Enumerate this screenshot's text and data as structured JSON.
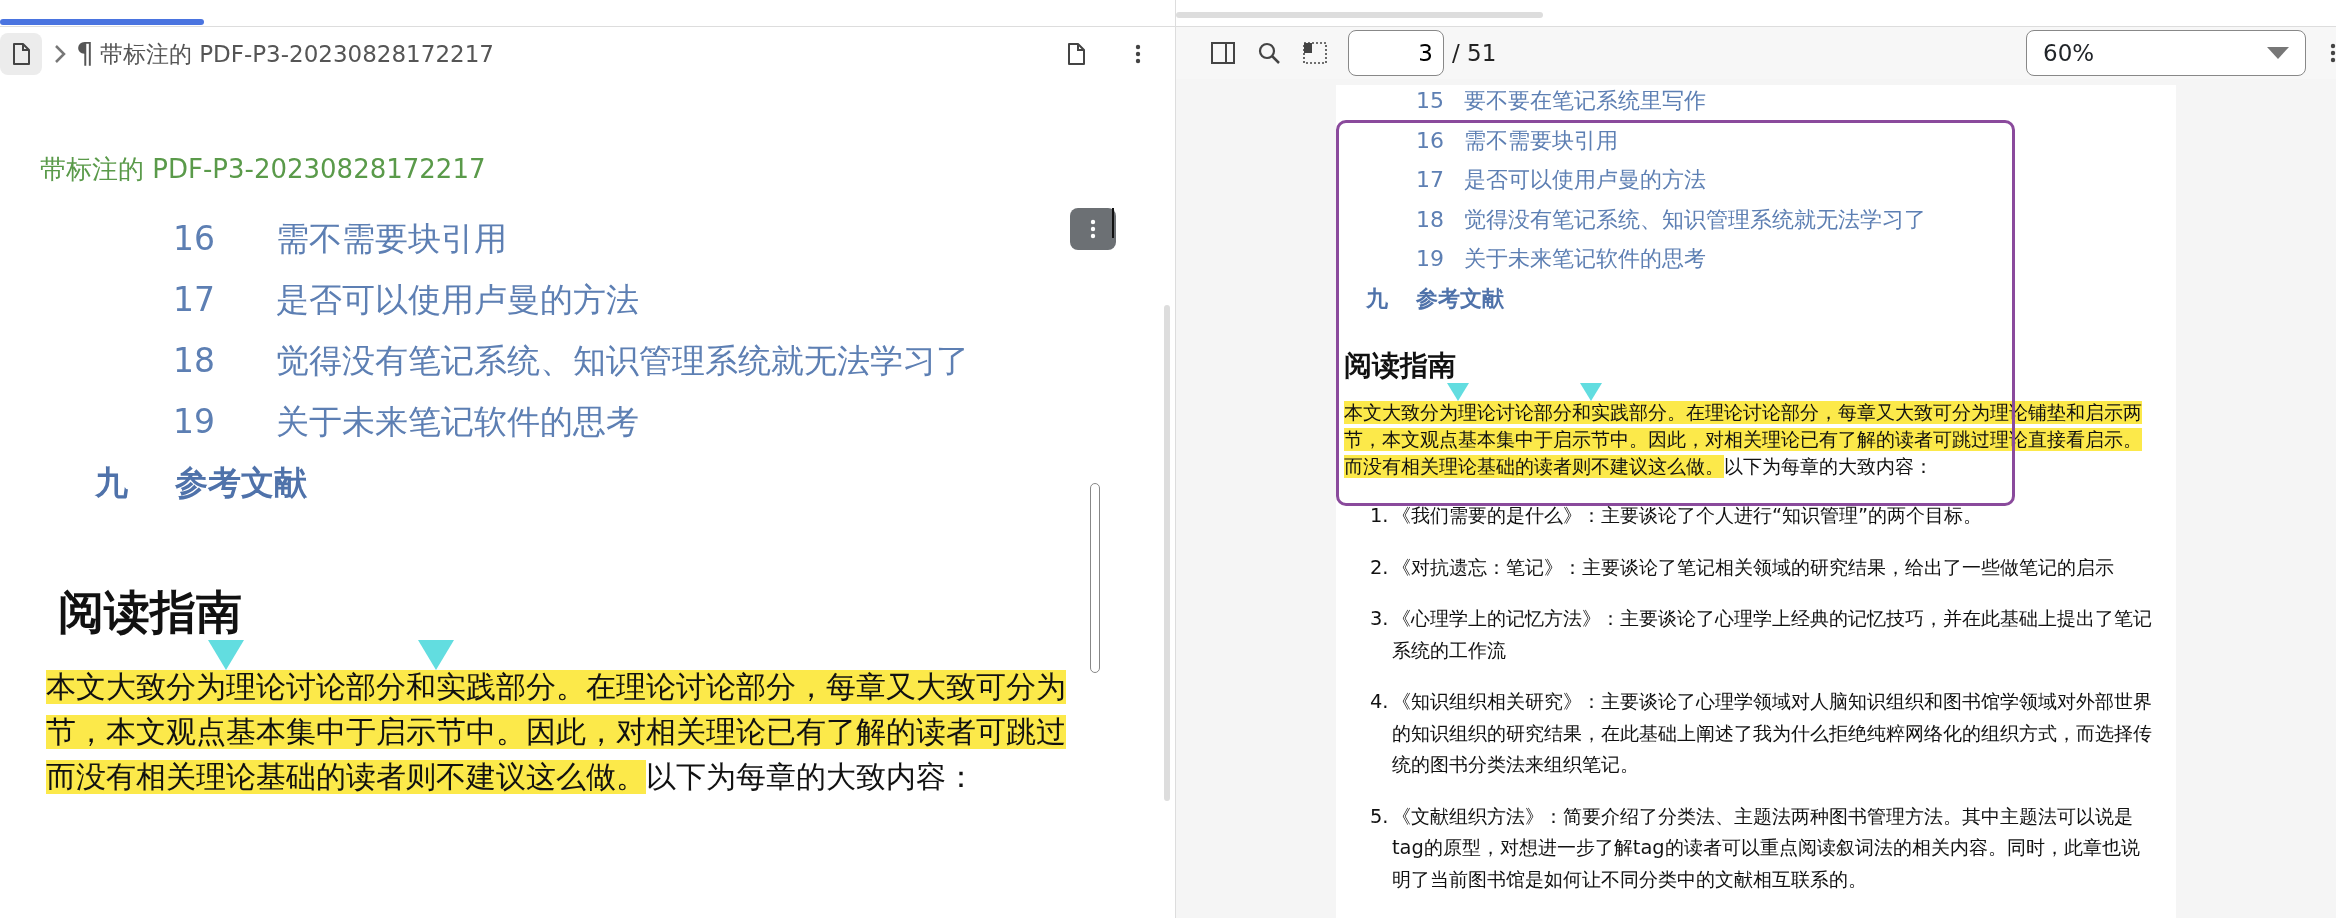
{
  "left_pane": {
    "header": {
      "pilcrow": "¶",
      "title": "带标注的 PDF-P3-20230828172217"
    },
    "note_title": "带标注的 PDF-P3-20230828172217",
    "image": {
      "toc": [
        {
          "number": "16",
          "text": "需不需要块引用"
        },
        {
          "number": "17",
          "text": "是否可以使用卢曼的方法"
        },
        {
          "number": "18",
          "text": "觉得没有笔记系统、知识管理系统就无法学习了"
        },
        {
          "number": "19",
          "text": "关于未来笔记软件的思考"
        }
      ],
      "chapter": {
        "number": "九",
        "text": "参考文献"
      },
      "heading": "阅读指南",
      "lines": [
        [
          {
            "kind": "text",
            "text": "本文大致分为",
            "highlighted": true
          },
          {
            "kind": "marker"
          },
          {
            "kind": "text",
            "text": "理论讨论部分和",
            "highlighted": true
          },
          {
            "kind": "marker"
          },
          {
            "kind": "text",
            "text": "实践部分。在理论讨论部分，每章又大致可分为",
            "highlighted": true
          }
        ],
        [
          {
            "kind": "text",
            "text": "节，本文观点基本集中于启示节中。因此，对相关理论已有了解的读者可跳过",
            "highlighted": true
          }
        ],
        [
          {
            "kind": "text",
            "text": "而没有相关理论基础的读者则不建议这么做。",
            "highlighted": true
          },
          {
            "kind": "text",
            "text": "以下为每章的大致内容：",
            "highlighted": false
          }
        ]
      ]
    }
  },
  "right_pane": {
    "toolbar": {
      "page": "3",
      "page_count": "/ 51",
      "zoom": "60%"
    },
    "page": {
      "toc": [
        {
          "number": "15",
          "text": "要不要在笔记系统里写作"
        },
        {
          "number": "16",
          "text": "需不需要块引用"
        },
        {
          "number": "17",
          "text": "是否可以使用卢曼的方法"
        },
        {
          "number": "18",
          "text": "觉得没有笔记系统、知识管理系统就无法学习了"
        },
        {
          "number": "19",
          "text": "关于未来笔记软件的思考"
        }
      ],
      "chapter": {
        "number": "九",
        "text": "参考文献"
      },
      "heading": "阅读指南",
      "paragraph_lines": [
        [
          {
            "kind": "text",
            "text": "本文大致分为",
            "highlighted": true
          },
          {
            "kind": "marker"
          },
          {
            "kind": "text",
            "text": "理论讨论部分和",
            "highlighted": true
          },
          {
            "kind": "marker"
          },
          {
            "kind": "text",
            "text": "实践部分。在理论讨论部分，每章又大致可分为理论铺垫和启示两",
            "highlighted": true
          }
        ],
        [
          {
            "kind": "text",
            "text": "节，本文观点基本集中于启示节中。因此，对相关理论已有了解的读者可跳过理论直接看启示。",
            "highlighted": true
          }
        ],
        [
          {
            "kind": "text",
            "text": "而没有相关理论基础的读者则不建议这么做。",
            "highlighted": true
          },
          {
            "kind": "text",
            "text": "以下为每章的大致内容：",
            "highlighted": false
          }
        ]
      ],
      "list": [
        {
          "number": "1.",
          "text": "《我们需要的是什么》：主要谈论了个人进行“知识管理”的两个目标。"
        },
        {
          "number": "2.",
          "text": "《对抗遗忘：笔记》：主要谈论了笔记相关领域的研究结果，给出了一些做笔记的启示"
        },
        {
          "number": "3.",
          "text": "《心理学上的记忆方法》：主要谈论了心理学上经典的记忆技巧，并在此基础上提出了笔记系统的工作流"
        },
        {
          "number": "4.",
          "text": "《知识组织相关研究》：主要谈论了心理学领域对人脑知识组织和图书馆学领域对外部世界的知识组织的研究结果，在此基础上阐述了我为什么拒绝纯粹网络化的组织方式，而选择传统的图书分类法来组织笔记。"
        },
        {
          "number": "5.",
          "text": "《文献组织方法》：简要介绍了分类法、主题法两种图书管理方法。其中主题法可以说是tag的原型，对想进一步了解tag的读者可以重点阅读叙词法的相关内容。同时，此章也说明了当前图书馆是如何让不同分类中的文献相互联系的。"
        }
      ]
    }
  }
}
